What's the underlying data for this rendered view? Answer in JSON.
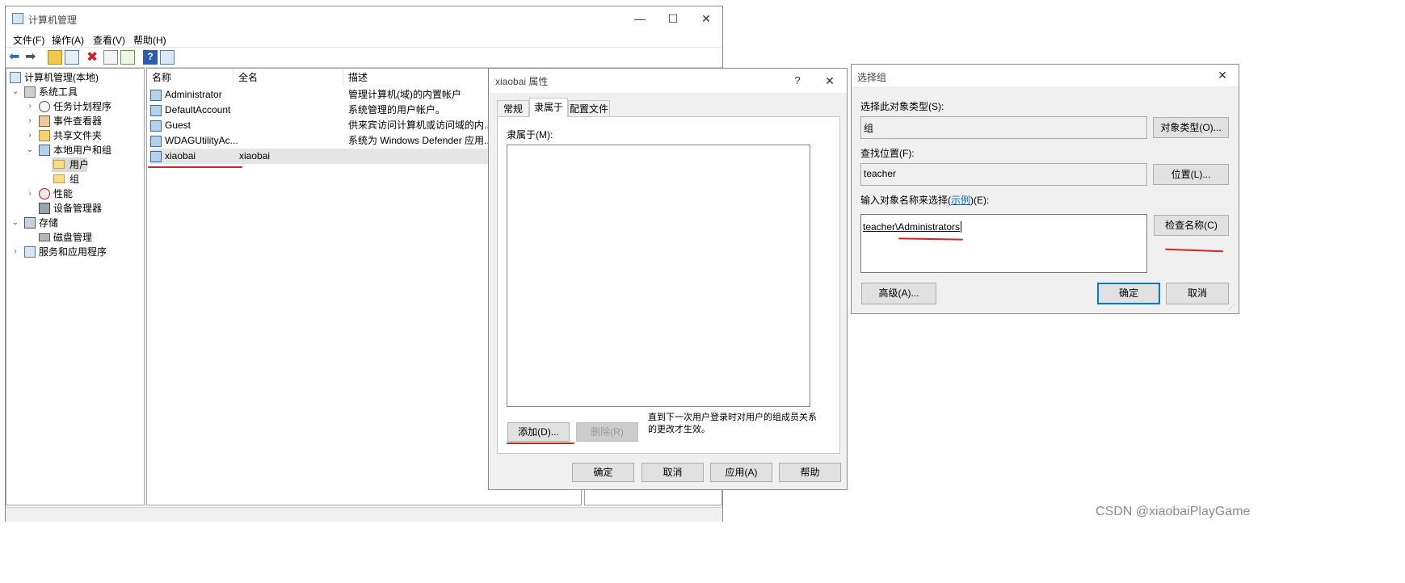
{
  "main_window": {
    "title": "计算机管理",
    "menu": [
      "文件(F)",
      "操作(A)",
      "查看(V)",
      "帮助(H)"
    ],
    "tree": [
      {
        "label": "计算机管理(本地)",
        "icon": "computer-management-icon"
      },
      {
        "label": "系统工具",
        "icon": "system-tools-icon"
      },
      {
        "label": "任务计划程序",
        "icon": "clock-icon"
      },
      {
        "label": "事件查看器",
        "icon": "event-viewer-icon"
      },
      {
        "label": "共享文件夹",
        "icon": "shared-folder-icon"
      },
      {
        "label": "本地用户和组",
        "icon": "users-icon"
      },
      {
        "label": "用户",
        "icon": "folder-icon"
      },
      {
        "label": "组",
        "icon": "folder-icon"
      },
      {
        "label": "性能",
        "icon": "performance-icon"
      },
      {
        "label": "设备管理器",
        "icon": "device-manager-icon"
      },
      {
        "label": "存储",
        "icon": "storage-icon"
      },
      {
        "label": "磁盘管理",
        "icon": "disk-icon"
      },
      {
        "label": "服务和应用程序",
        "icon": "services-icon"
      }
    ],
    "columns": [
      "名称",
      "全名",
      "描述"
    ],
    "users": [
      {
        "name": "Administrator",
        "fullname": "",
        "desc": "管理计算机(域)的内置帐户"
      },
      {
        "name": "DefaultAccount",
        "fullname": "",
        "desc": "系统管理的用户帐户。"
      },
      {
        "name": "Guest",
        "fullname": "",
        "desc": "供来宾访问计算机或访问域的内..."
      },
      {
        "name": "WDAGUtilityAc...",
        "fullname": "",
        "desc": "系统为 Windows Defender 应用..."
      },
      {
        "name": "xiaobai",
        "fullname": "xiaobai",
        "desc": ""
      }
    ]
  },
  "props_dialog": {
    "title": "xiaobai 属性",
    "help_glyph": "?",
    "tabs": [
      "常规",
      "隶属于",
      "配置文件"
    ],
    "member_of_label": "隶属于(M):",
    "add_label": "添加(D)...",
    "remove_label": "删除(R)",
    "note": "直到下一次用户登录时对用户的组成员关系的更改才生效。",
    "ok_label": "确定",
    "cancel_label": "取消",
    "apply_label": "应用(A)",
    "help_label": "帮助"
  },
  "select_dialog": {
    "title": "选择组",
    "object_type_label": "选择此对象类型(S):",
    "object_type_value": "组",
    "object_type_button": "对象类型(O)...",
    "location_label": "查找位置(F):",
    "location_value": "teacher",
    "location_button": "位置(L)...",
    "names_label_pre": "输入对象名称来选择(",
    "names_label_link": "示例",
    "names_label_post": ")(E):",
    "names_value": "teacher\\Administrators",
    "check_names_button": "检查名称(C)",
    "advanced_button": "高级(A)...",
    "ok_label": "确定",
    "cancel_label": "取消"
  },
  "watermark": "CSDN @xiaobaiPlayGame",
  "colors": {
    "accent": "#0078d7",
    "annotation": "#e02020",
    "link": "#0066cc"
  }
}
